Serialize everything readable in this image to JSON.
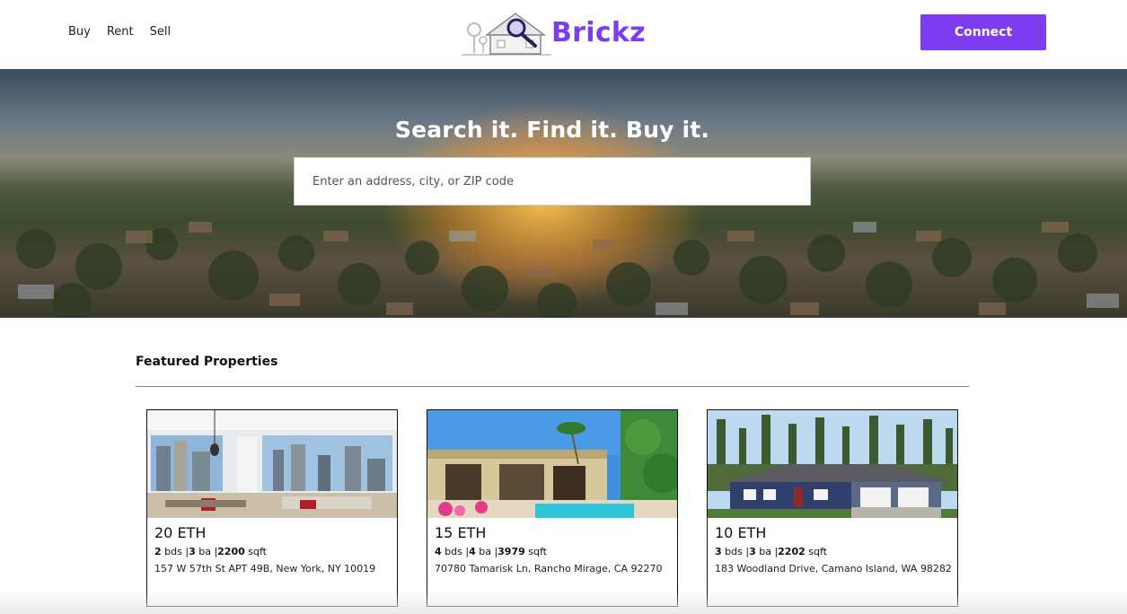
{
  "nav": {
    "buy": "Buy",
    "rent": "Rent",
    "sell": "Sell"
  },
  "brand": {
    "name": "Brickz",
    "accent": "#7d3cf0"
  },
  "header": {
    "connect_label": "Connect"
  },
  "hero": {
    "title": "Search it. Find it. Buy it.",
    "search_placeholder": "Enter an address, city, or ZIP code"
  },
  "featured": {
    "title": "Featured Properties",
    "cards": [
      {
        "price": "20 ETH",
        "beds": "2",
        "beds_unit": "bds",
        "baths": "3",
        "baths_unit": "ba",
        "sqft": "2200",
        "sqft_unit": "sqft",
        "address": "157 W 57th St APT 49B, New York, NY 10019",
        "photo": "apartment-interior"
      },
      {
        "price": "15 ETH",
        "beds": "4",
        "beds_unit": "bds",
        "baths": "4",
        "baths_unit": "ba",
        "sqft": "3979",
        "sqft_unit": "sqft",
        "address": "70780 Tamarisk Ln, Rancho Mirage, CA 92270",
        "photo": "pool-house"
      },
      {
        "price": "10 ETH",
        "beds": "3",
        "beds_unit": "bds",
        "baths": "3",
        "baths_unit": "ba",
        "sqft": "2202",
        "sqft_unit": "sqft",
        "address": "183 Woodland Drive, Camano Island, WA 98282",
        "photo": "forest-house"
      }
    ]
  }
}
